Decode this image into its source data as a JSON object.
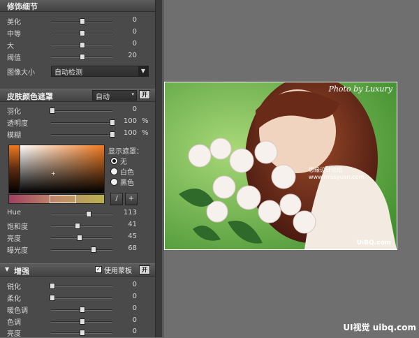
{
  "detail": {
    "title": "修饰细节",
    "rows": [
      {
        "label": "美化",
        "value": "0",
        "pos": 0.5
      },
      {
        "label": "中等",
        "value": "0",
        "pos": 0.5
      },
      {
        "label": "大",
        "value": "0",
        "pos": 0.5
      },
      {
        "label": "阈值",
        "value": "20",
        "pos": 0.5
      }
    ],
    "image_size_label": "图像大小",
    "image_size_value": "自动检测"
  },
  "skin": {
    "title": "皮肤颜色遮罩",
    "mode": "自动",
    "on_button": "开",
    "rows": [
      {
        "label": "羽化",
        "value": "0",
        "unit": "",
        "pos": 0.0
      },
      {
        "label": "透明度",
        "value": "100",
        "unit": "%",
        "pos": 1.0
      },
      {
        "label": "模糊",
        "value": "100",
        "unit": "%",
        "pos": 1.0
      }
    ],
    "display_mask_label": "显示遮罩：",
    "mask_options": [
      {
        "label": "无",
        "selected": true
      },
      {
        "label": "白色",
        "selected": false
      },
      {
        "label": "黑色",
        "selected": false
      }
    ],
    "tool1": "/",
    "tool2": "+",
    "hsl_rows": [
      {
        "label": "Hue",
        "value": "113",
        "pos": 0.6
      },
      {
        "label": "饱和度",
        "value": "41",
        "pos": 0.4
      },
      {
        "label": "亮度",
        "value": "45",
        "pos": 0.45
      },
      {
        "label": "曝光度",
        "value": "68",
        "pos": 0.68
      }
    ]
  },
  "enhance": {
    "title": "增强",
    "use_mask_label": "使用蒙板",
    "use_mask_checked": true,
    "on_button": "开",
    "rows": [
      {
        "label": "锐化",
        "value": "0",
        "pos": 0.0
      },
      {
        "label": "柔化",
        "value": "0",
        "pos": 0.0
      },
      {
        "label": "暖色调",
        "value": "0",
        "pos": 0.5
      },
      {
        "label": "色调",
        "value": "0",
        "pos": 0.5
      },
      {
        "label": "亮度",
        "value": "0",
        "pos": 0.5
      }
    ]
  },
  "photo": {
    "watermark_top": "Photo by Luxury",
    "watermark_mid": "思缘设计论坛  www.missyuan.com",
    "watermark_bottom": "UiBQ.com"
  },
  "footer_watermark": "UI视觉 uibq.com",
  "colors": {
    "panel": "#4a4a4a",
    "canvas": "#6f6f6f",
    "accent": "#f07a20"
  }
}
